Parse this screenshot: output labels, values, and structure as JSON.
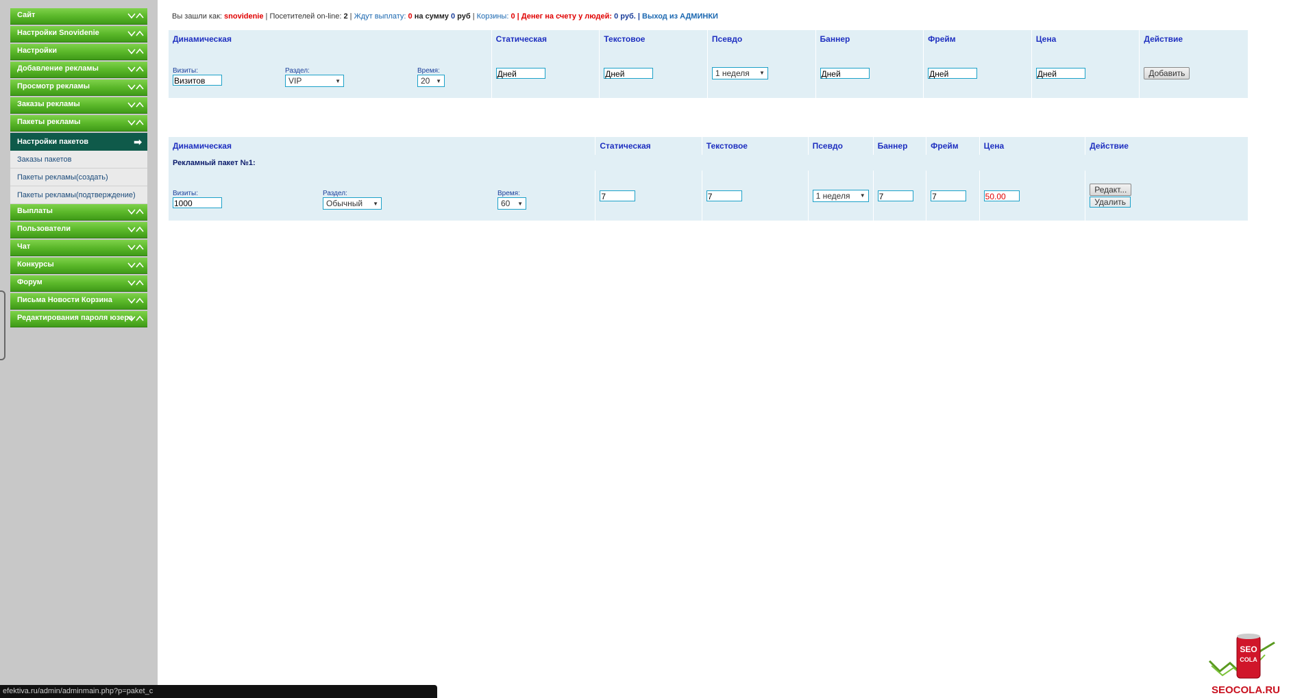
{
  "sidebar": {
    "items_top": [
      {
        "label": "Сайт"
      },
      {
        "label": "Настройки Snovidenie"
      },
      {
        "label": "Настройки"
      },
      {
        "label": "Добавление рекламы"
      },
      {
        "label": "Просмотр рекламы"
      },
      {
        "label": "Заказы рекламы"
      },
      {
        "label": "Пакеты рекламы"
      }
    ],
    "submenu": [
      {
        "label": "Настройки пакетов",
        "active": true
      },
      {
        "label": "Заказы пакетов"
      },
      {
        "label": "Пакеты рекламы(создать)"
      },
      {
        "label": "Пакеты рекламы(подтверждение)"
      }
    ],
    "items_bottom": [
      {
        "label": "Выплаты"
      },
      {
        "label": "Пользователи"
      },
      {
        "label": "Чат"
      },
      {
        "label": "Конкурсы"
      },
      {
        "label": "Форум"
      },
      {
        "label": "Письма Новости Корзина"
      },
      {
        "label": "Редактирования пароля юзера"
      }
    ],
    "active_arrow": "➡"
  },
  "topline": {
    "logged_as_label": "Вы зашли как:",
    "username": "snovidenie",
    "sep1": "|",
    "visitors_label": "Посетителей on-line:",
    "visitors_count": "2",
    "sep2": "|",
    "await_label": "Ждут выплату:",
    "await_count": "0",
    "sum_label": "на сумму",
    "sum_value": "0",
    "rub1": "руб",
    "sep3": "|",
    "carts_label": "Корзины:",
    "carts_value": "0",
    "sep4": "|",
    "money_label": "Денег на счету у людей:",
    "money_value": "0 руб.",
    "sep5": "|",
    "exit_label": "Выход из АДМИНКИ"
  },
  "table_add": {
    "headers": [
      "Динамическая",
      "Статическая",
      "Текстовое",
      "Псевдо",
      "Баннер",
      "Фрейм",
      "Цена",
      "Действие"
    ],
    "visits_label": "Визиты:",
    "visits_value": "Визитов",
    "section_label": "Раздел:",
    "section_value": "VIP",
    "time_label": "Время:",
    "time_value": "20",
    "static_value": "Дней",
    "text_value": "Дней",
    "pseudo_value": "1 неделя",
    "banner_value": "Дней",
    "frame_value": "Дней",
    "price_value": "Дней",
    "add_button": "Добавить"
  },
  "table_packets": {
    "headers": [
      "Динамическая",
      "Статическая",
      "Текстовое",
      "Псевдо",
      "Баннер",
      "Фрейм",
      "Цена",
      "Действие"
    ],
    "packet_title": "Рекламный пакет №1:",
    "visits_label": "Визиты:",
    "visits_value": "1000",
    "section_label": "Раздел:",
    "section_value": "Обычный",
    "time_label": "Время:",
    "time_value": "60",
    "static_value": "7",
    "text_value": "7",
    "pseudo_value": "1 неделя",
    "banner_value": "7",
    "frame_value": "7",
    "price_value": "50.00",
    "edit_button": "Редакт...",
    "delete_button": "Удалить"
  },
  "statusbar": {
    "url": "efektiva.ru/admin/adminmain.php?p=paket_c"
  },
  "logo": {
    "brand_top": "SEO",
    "brand_bottom": "COLA",
    "brand_url": "SEOCOLA.RU"
  },
  "colors": {
    "menu_green": "#5bb82a",
    "active_submenu": "#0f5a4a",
    "header_blue": "#1e2fc0",
    "cell_bg": "#e1eff5",
    "accent_red": "#e00000"
  }
}
